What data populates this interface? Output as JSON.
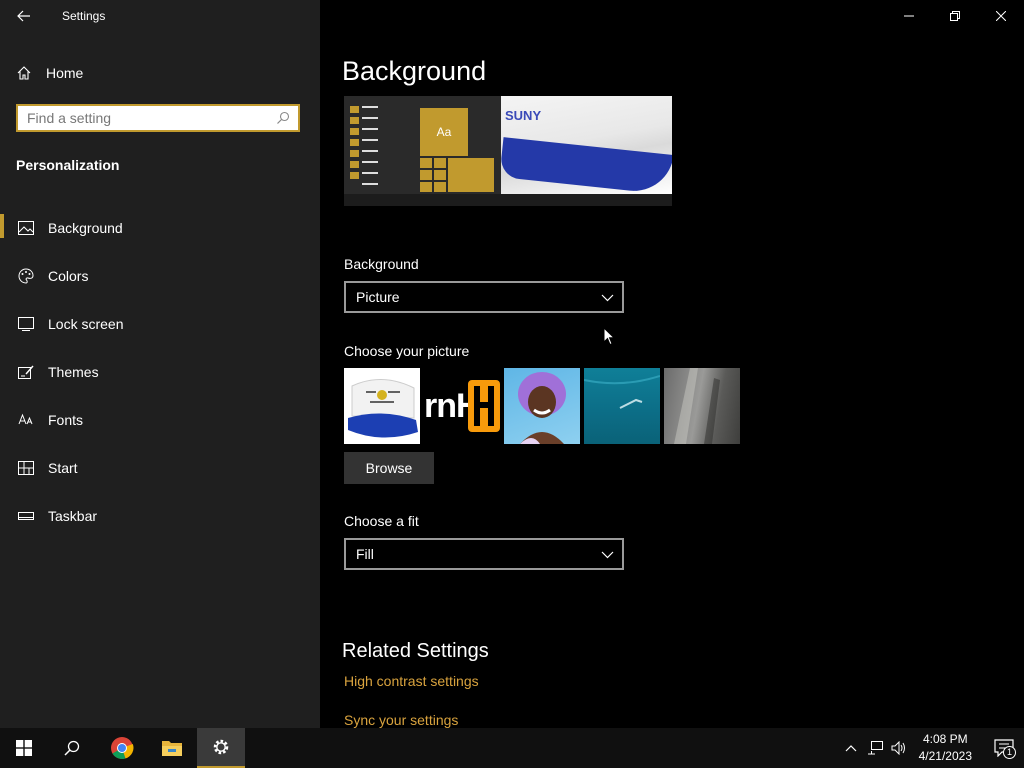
{
  "window": {
    "title": "Settings"
  },
  "sidebar": {
    "home_label": "Home",
    "search_placeholder": "Find a setting",
    "section_title": "Personalization",
    "items": [
      {
        "label": "Background",
        "icon": "picture-icon",
        "active": true
      },
      {
        "label": "Colors",
        "icon": "palette-icon",
        "active": false
      },
      {
        "label": "Lock screen",
        "icon": "lock-screen-icon",
        "active": false
      },
      {
        "label": "Themes",
        "icon": "themes-icon",
        "active": false
      },
      {
        "label": "Fonts",
        "icon": "fonts-icon",
        "active": false
      },
      {
        "label": "Start",
        "icon": "start-icon",
        "active": false
      },
      {
        "label": "Taskbar",
        "icon": "taskbar-icon",
        "active": false
      }
    ]
  },
  "main": {
    "title": "Background",
    "preview": {
      "tile_text": "Aa",
      "image_text": "SUNY"
    },
    "background_label": "Background",
    "background_value": "Picture",
    "choose_picture_label": "Choose your picture",
    "thumbs": [
      "hat-photo",
      "rnh-logo",
      "woman-purple-wig",
      "underwater-swimmer",
      "rock-cliff"
    ],
    "thumb_logo_text": "rnH",
    "browse_label": "Browse",
    "fit_label": "Choose a fit",
    "fit_value": "Fill",
    "related_title": "Related Settings",
    "links": [
      "High contrast settings",
      "Sync your settings"
    ]
  },
  "taskbar": {
    "time": "4:08 PM",
    "date": "4/21/2023",
    "notification_count": "1"
  },
  "colors": {
    "accent": "#c19a2e",
    "link": "#d9a33e",
    "sidebar": "#1f1f1f",
    "background": "#000000"
  }
}
